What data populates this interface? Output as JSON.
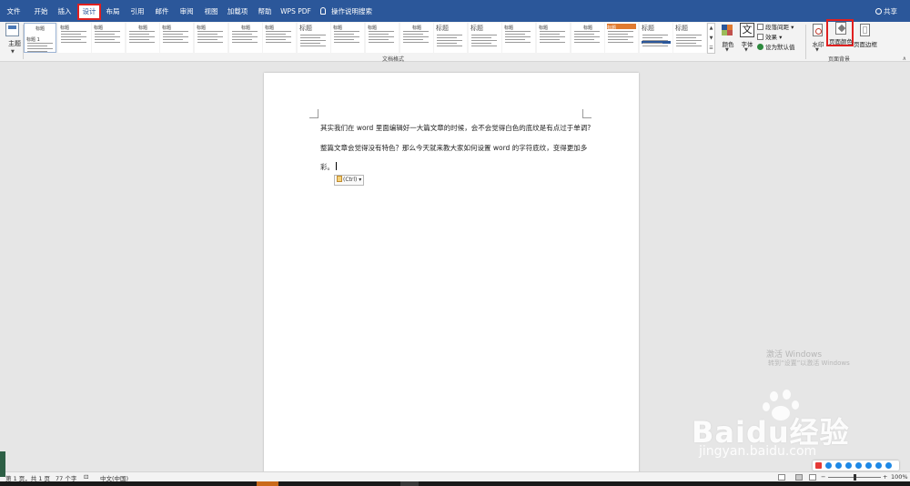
{
  "menubar": {
    "tabs": [
      {
        "label": "文件"
      },
      {
        "label": "开始"
      },
      {
        "label": "插入"
      },
      {
        "label": "设计",
        "active": true
      },
      {
        "label": "布局"
      },
      {
        "label": "引用"
      },
      {
        "label": "邮件"
      },
      {
        "label": "审阅"
      },
      {
        "label": "视图"
      },
      {
        "label": "加载项"
      },
      {
        "label": "帮助"
      },
      {
        "label": "WPS PDF"
      }
    ],
    "search": "操作说明搜索",
    "share": "共享"
  },
  "ribbon": {
    "theme_label": "主题",
    "styles_group_label": "文档格式",
    "styles": [
      {
        "title": "标题",
        "subtitle": "标题 1"
      },
      {
        "title": "标题"
      },
      {
        "title": "标题"
      },
      {
        "title": "标题"
      },
      {
        "title": "标题"
      },
      {
        "title": "标题"
      },
      {
        "title": "标题"
      },
      {
        "title": "标题"
      },
      {
        "title": "标题"
      },
      {
        "title": "标题"
      },
      {
        "title": "标题"
      },
      {
        "title": "标题"
      },
      {
        "title": "标题"
      },
      {
        "title": "标题"
      },
      {
        "title": "标题"
      },
      {
        "title": "标题"
      },
      {
        "title": "标题"
      },
      {
        "title": "标题"
      },
      {
        "title": "标题"
      },
      {
        "title": "标题"
      }
    ],
    "colors_label": "颜色",
    "fonts_label": "字体",
    "fonts_glyph": "文",
    "paragraph_spacing": "段落间距",
    "effects": "效果",
    "set_default": "设为默认值",
    "watermark": "水印",
    "page_color": "页面颜色",
    "page_border": "页面边框",
    "page_bg_group_label": "页面背景",
    "accent_colors": [
      "#e07a2f",
      "#2b579a",
      "#5b8fd0",
      "#7a9bd0"
    ]
  },
  "document": {
    "paragraphs": [
      "其实我们在 word 里面编辑好一大篇文章的时候，会不会觉得白色的底纹是有点过于单调?",
      "整篇文章会觉得没有特色？那么今天就来教大家如何设置 word 的字符底纹，变得更加多",
      "彩。"
    ],
    "paste_options": "(Ctrl)"
  },
  "statusbar": {
    "page_info": "第 1 页，共 1 页",
    "word_count": "77 个字",
    "language": "中文(中国)",
    "zoom_percent": "100%",
    "zoom_level": 0.5
  },
  "overlay": {
    "win_activate_title": "激活 Windows",
    "win_activate_hint": "转到“设置”以激活 Windows",
    "baidu_logo": "Baidu经验",
    "baidu_url": "jingyan.baidu.com"
  }
}
